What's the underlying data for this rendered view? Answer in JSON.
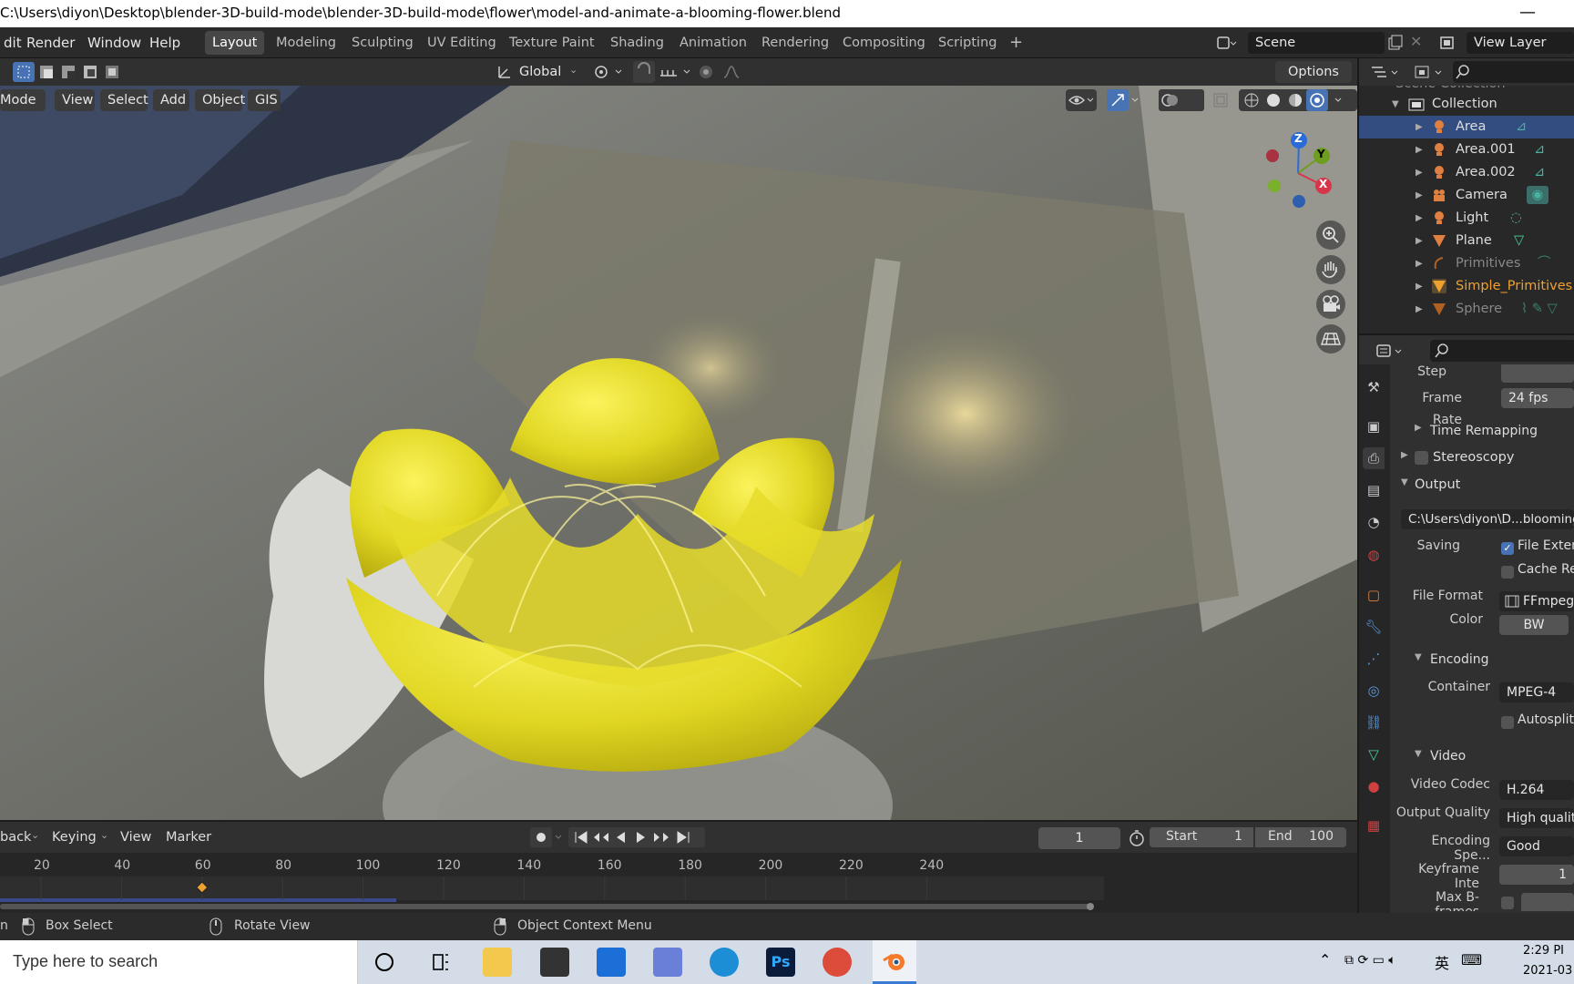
{
  "window": {
    "title": "C:\\Users\\diyon\\Desktop\\blender-3D-build-mode\\blender-3D-build-mode\\flower\\model-and-animate-a-blooming-flower.blend",
    "minimize_glyph": "—"
  },
  "menubar": {
    "items": [
      "dit",
      "Render",
      "Window",
      "Help"
    ]
  },
  "workspaces": {
    "active": "Layout",
    "tabs": [
      "Layout",
      "Modeling",
      "Sculpting",
      "UV Editing",
      "Texture Paint",
      "Shading",
      "Animation",
      "Rendering",
      "Compositing",
      "Scripting"
    ],
    "add_label": "+"
  },
  "scene": {
    "name": "Scene"
  },
  "view_layer": {
    "name": "View Layer"
  },
  "toolbar": {
    "transform_orientation": "Global",
    "options_label": "Options"
  },
  "viewport_header": {
    "mode_label": "Mode",
    "menus": [
      "View",
      "Select",
      "Add",
      "Object",
      "GIS"
    ]
  },
  "gizmo": {
    "z": "Z",
    "y": "Y",
    "x": "X"
  },
  "outliner": {
    "header": "Scene Collection",
    "collection": "Collection",
    "items": [
      {
        "label": "Area",
        "icon": "area-light-icon",
        "selected": true
      },
      {
        "label": "Area.001",
        "icon": "area-light-icon",
        "selected": false
      },
      {
        "label": "Area.002",
        "icon": "area-light-icon",
        "selected": false
      },
      {
        "label": "Camera",
        "icon": "camera-icon",
        "selected": false
      },
      {
        "label": "Light",
        "icon": "light-icon",
        "selected": false
      },
      {
        "label": "Plane",
        "icon": "mesh-icon",
        "selected": false
      },
      {
        "label": "Primitives",
        "icon": "curve-icon",
        "selected": false
      },
      {
        "label": "Simple_Primitives",
        "icon": "mesh-icon",
        "selected": false
      },
      {
        "label": "Sphere",
        "icon": "mesh-icon",
        "selected": false
      }
    ]
  },
  "properties": {
    "step_label": "Step",
    "frame_rate_label": "Frame Rate",
    "frame_rate_value": "24 fps",
    "time_remapping": "Time Remapping",
    "stereoscopy": "Stereoscopy",
    "output": "Output",
    "output_path": "C:\\Users\\diyon\\D...blooming-",
    "saving_label": "Saving",
    "file_extensions": "File Exten",
    "cache_result": "Cache Re",
    "file_format_label": "File Format",
    "file_format_value": "FFmpeg",
    "color_label": "Color",
    "color_value": "BW",
    "encoding": "Encoding",
    "container_label": "Container",
    "container_value": "MPEG-4",
    "autosplit": "Autosplit",
    "video": "Video",
    "video_codec_label": "Video Codec",
    "video_codec_value": "H.264",
    "output_quality_label": "Output Quality",
    "output_quality_value": "High quality",
    "encoding_speed_label": "Encoding Spe...",
    "encoding_speed_value": "Good",
    "keyframe_interval_label": "Keyframe Inte",
    "keyframe_interval_value": "1",
    "max_bframes_label": "Max B-frames"
  },
  "timeline": {
    "playback_label": "back",
    "keying_label": "Keying",
    "view_label": "View",
    "marker_label": "Marker",
    "current_frame": "1",
    "start_label": "Start",
    "start_value": "1",
    "end_label": "End",
    "end_value": "100",
    "ruler": [
      "20",
      "40",
      "60",
      "80",
      "100",
      "120",
      "140",
      "160",
      "180",
      "200",
      "220",
      "240"
    ],
    "keyframe_at": 60
  },
  "statusbar": {
    "items": [
      "n",
      "Box Select",
      "Rotate View",
      "Object Context Menu"
    ]
  },
  "taskbar": {
    "search_placeholder": "Type here to search",
    "time": "2:29 PI",
    "date": "2021-03",
    "ime": "英"
  },
  "colors": {
    "selection_blue": "#334d80",
    "flower_yellow": "#e8e030",
    "accent_blue": "#4772b3"
  }
}
